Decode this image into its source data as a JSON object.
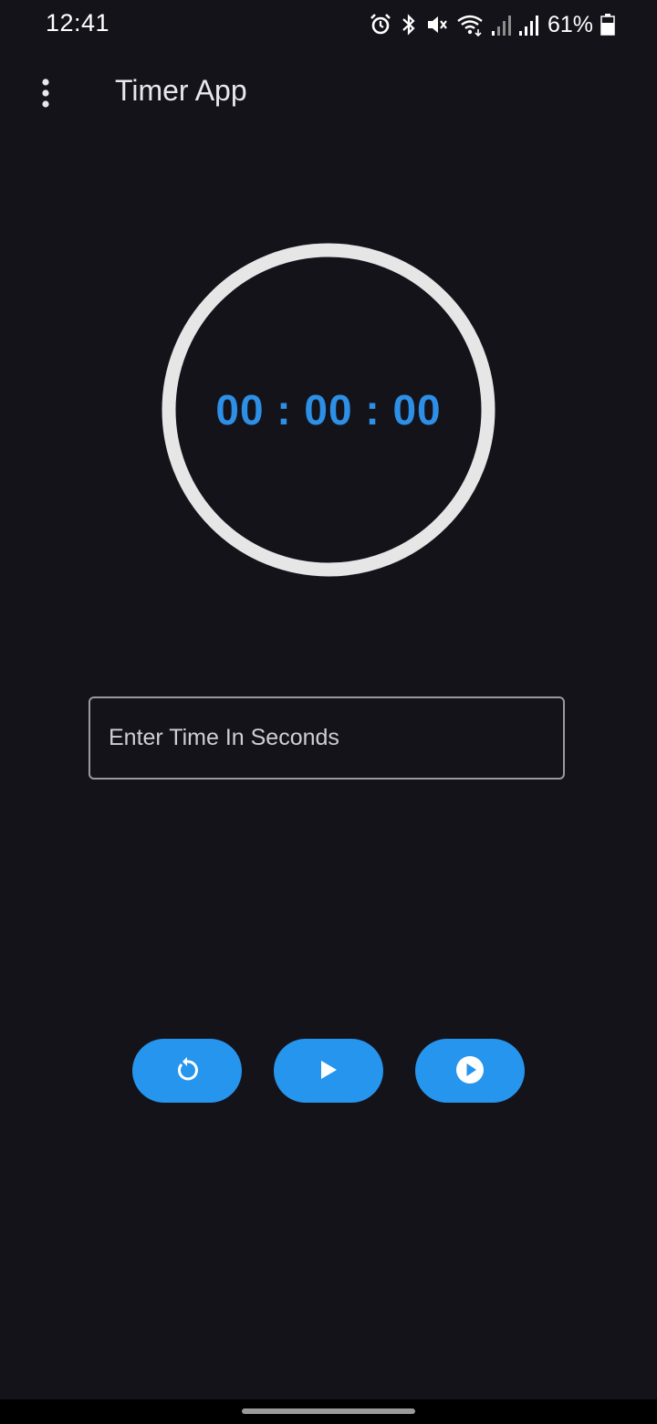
{
  "status_bar": {
    "time": "12:41",
    "battery_percent": "61%",
    "icons": [
      "alarm-icon",
      "bluetooth-icon",
      "mute-icon",
      "wifi-icon",
      "signal-icon",
      "signal-icon",
      "battery-icon"
    ]
  },
  "app_bar": {
    "title": "Timer App",
    "menu_icon": "more-vert-icon"
  },
  "timer": {
    "display": "00 : 00 : 00",
    "progress": 0,
    "ring_color": "#e6e6e6",
    "text_color": "#2d8fe6"
  },
  "input": {
    "placeholder": "Enter Time In Seconds",
    "value": ""
  },
  "controls": {
    "reset_icon": "restart-icon",
    "start_icon": "play-icon",
    "resume_icon": "play-circle-icon",
    "button_color": "#2695ee"
  },
  "theme": {
    "background": "#15131a",
    "accent": "#2695ee"
  }
}
